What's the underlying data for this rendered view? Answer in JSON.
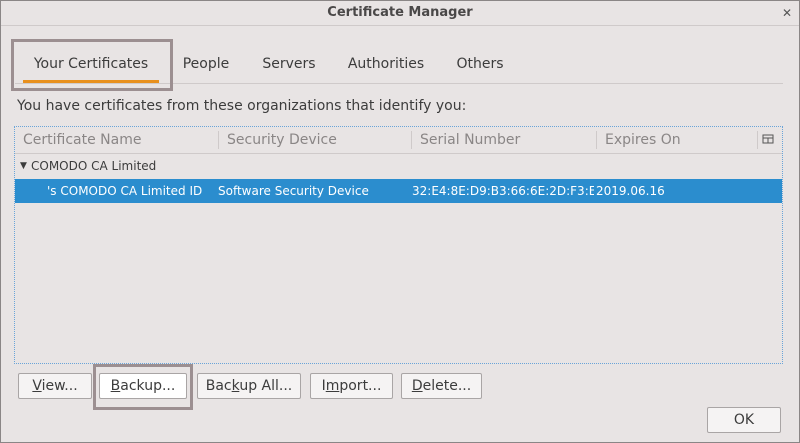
{
  "window": {
    "title": "Certificate Manager"
  },
  "tabs": [
    {
      "label": "Your Certificates"
    },
    {
      "label": "People"
    },
    {
      "label": "Servers"
    },
    {
      "label": "Authorities"
    },
    {
      "label": "Others"
    }
  ],
  "intro_text": "You have certificates from these organizations that identify you:",
  "table": {
    "columns": [
      "Certificate Name",
      "Security Device",
      "Serial Number",
      "Expires On"
    ],
    "groups": [
      {
        "name": "COMODO CA Limited",
        "rows": [
          {
            "certificate_name": "'s COMODO CA Limited ID",
            "security_device": "Software Security Device",
            "serial_number": "32:E4:8E:D9:B3:66:6E:2D:F3:E...",
            "expires_on": "2019.06.16"
          }
        ]
      }
    ]
  },
  "buttons": {
    "view": {
      "pre": "",
      "ul": "V",
      "post": "iew..."
    },
    "backup": {
      "pre": "",
      "ul": "B",
      "post": "ackup..."
    },
    "backup_all": {
      "pre": "Bac",
      "ul": "k",
      "post": "up All..."
    },
    "import": {
      "pre": "I",
      "ul": "m",
      "post": "port..."
    },
    "delete": {
      "pre": "",
      "ul": "D",
      "post": "elete..."
    },
    "ok": {
      "pre": "",
      "ul": "",
      "post": "OK"
    }
  },
  "colors": {
    "accent_tab_underline": "#e8901e",
    "selection": "#2b8dce",
    "highlight_box": "#9c8f91"
  }
}
